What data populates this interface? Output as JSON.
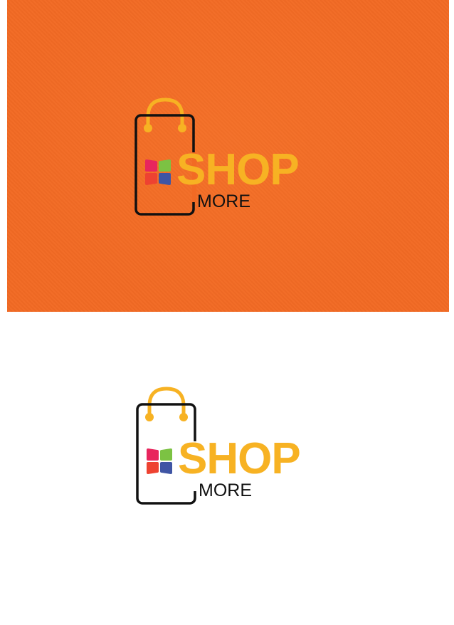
{
  "logos": {
    "top": {
      "word_shop": "SHOP",
      "word_more": "MORE",
      "background": "#f26a24"
    },
    "bottom": {
      "word_shop": "SHOP",
      "word_more": "MORE",
      "background": "#ffffff"
    }
  },
  "colors": {
    "shop_text": "#f7b223",
    "more_text": "#111111",
    "bag_outline": "#111111",
    "bag_handle": "#f7b223",
    "tile_pink": "#e8255d",
    "tile_green": "#7cc243",
    "tile_red": "#ee4231",
    "tile_blue": "#3f55a4"
  },
  "icons": {
    "bag": "shopping-bag-icon",
    "tiles": "four-color-tiles-icon"
  }
}
